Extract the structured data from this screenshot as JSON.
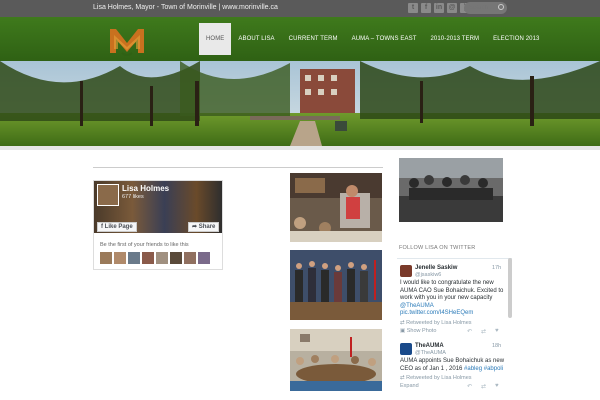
{
  "topbar": {
    "tagline": "Lisa Holmes, Mayor - Town of Morinville | www.morinville.ca",
    "social_icons": [
      "twitter-icon",
      "facebook-icon",
      "linkedin-icon",
      "email-icon",
      "rss-icon"
    ],
    "search_placeholder": "Search ..."
  },
  "nav": {
    "items": [
      "HOME",
      "ABOUT LISA",
      "CURRENT TERM",
      "AUMA – TOWNS EAST",
      "2010-2013 TERM",
      "ELECTION 2013"
    ],
    "active": "HOME"
  },
  "colors": {
    "header_green": "#3a6e1b",
    "topbar_gray": "#5a5a5a",
    "twitter_blue": "#2b7bb9"
  },
  "facebook": {
    "name": "Lisa Holmes",
    "likes": "677 likes",
    "like_button": "Like Page",
    "share_button": "Share",
    "friends_text": "Be the first of your friends to like this"
  },
  "sidebar": {
    "follow_heading": "FOLLOW LISA ON TWITTER"
  },
  "tweets": [
    {
      "name": "Jenelle Saskiw",
      "handle": "@jsaskiw6",
      "time": "17h",
      "text": "I would like to congratulate the new AUMA CAO Sue Bohaichuk. Excited to work with you in your new capacity",
      "mention": "@TheAUMA",
      "link": "pic.twitter.com/I4SHeEQem",
      "retweeted": "Retweeted by Lisa Holmes",
      "action": "Show Photo"
    },
    {
      "name": "TheAUMA",
      "handle": "@TheAUMA",
      "time": "18h",
      "text": "AUMA appoints Sue Bohaichuk as new CEO as of Jan 1 , 2016",
      "hashtags": "#ableg #abpoli",
      "retweeted": "Retweeted by Lisa Holmes",
      "action": "Expand"
    }
  ]
}
